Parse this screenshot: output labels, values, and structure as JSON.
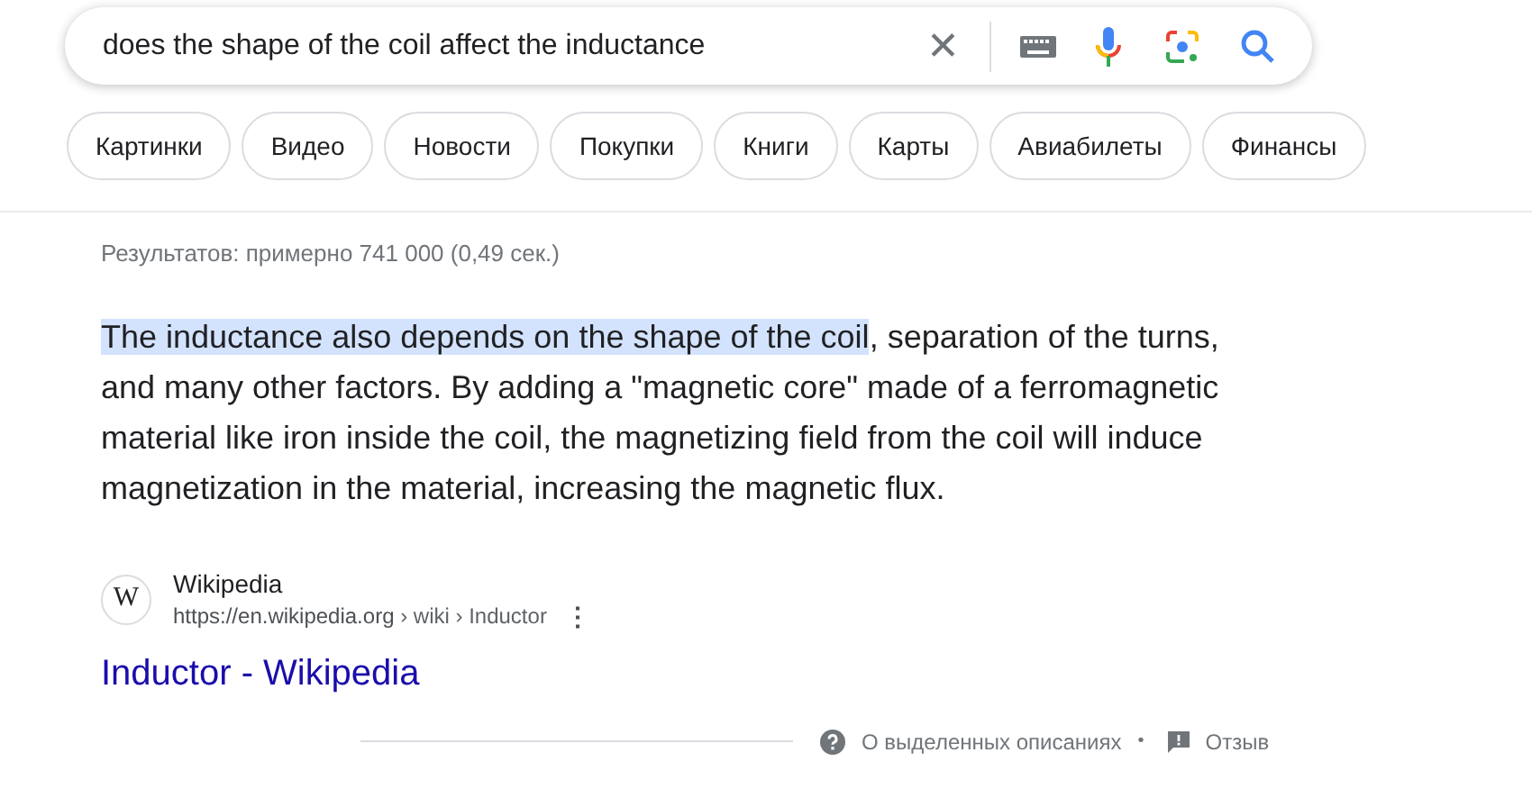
{
  "search": {
    "value": "does the shape of the coil affect the inductance",
    "clear": "✕"
  },
  "chips": [
    "Картинки",
    "Видео",
    "Новости",
    "Покупки",
    "Книги",
    "Карты",
    "Авиабилеты",
    "Финансы"
  ],
  "result_stats": "Результатов: примерно 741 000 (0,49 сек.)",
  "snippet": {
    "highlight": "The inductance also depends on the shape of the coil",
    "rest": ", separation of the turns, and many other factors. By adding a \"magnetic core\" made of a ferromagnetic material like iron inside the coil, the magnetizing field from the coil will induce magnetization in the material, increasing the magnetic flux."
  },
  "source": {
    "favicon": "W",
    "site": "Wikipedia",
    "url": "https://en.wikipedia.org",
    "path": " › wiki › Inductor",
    "more": "⋮",
    "title": "Inductor - Wikipedia"
  },
  "footer": {
    "about": "О выделенных описаниях",
    "separator": "•",
    "feedback": "Отзыв"
  }
}
